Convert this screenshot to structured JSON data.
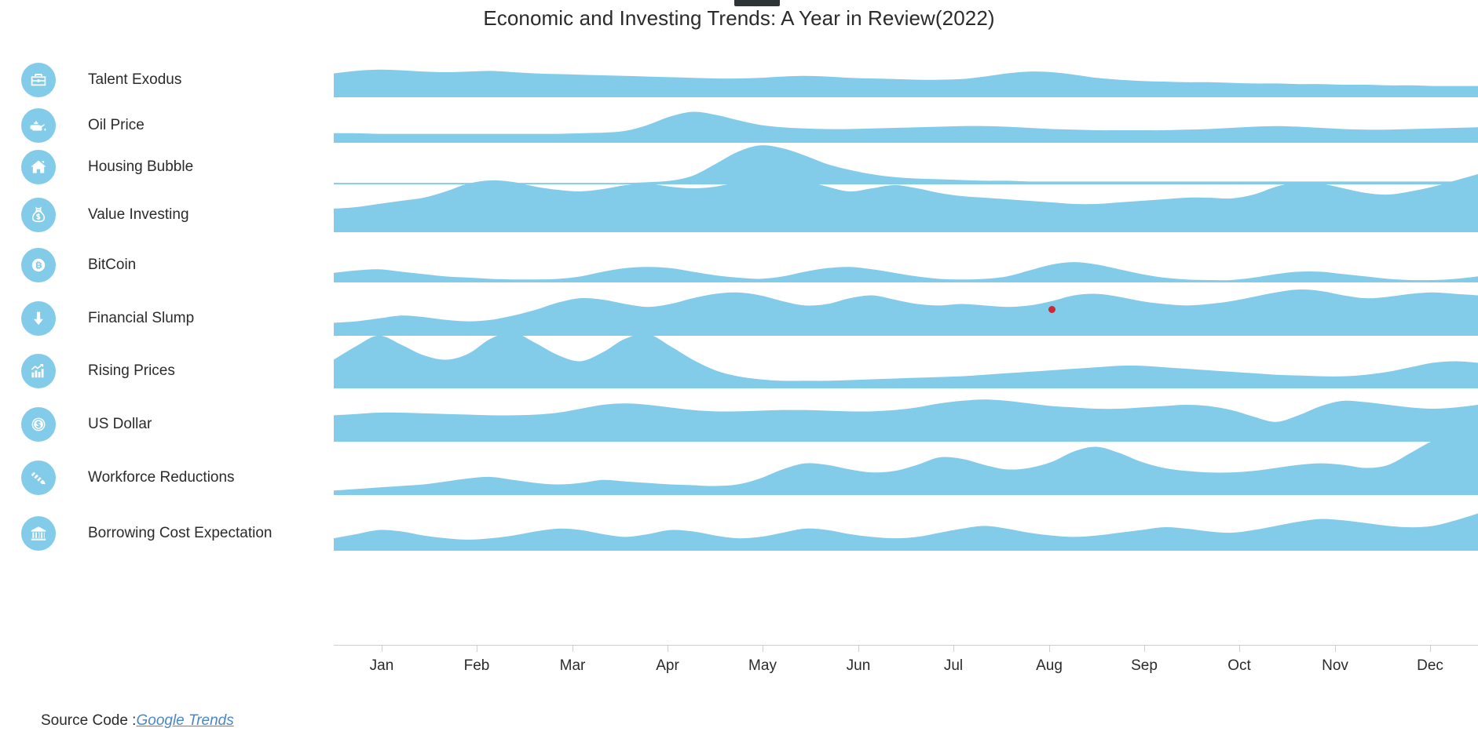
{
  "header": {
    "title": "Economic and Investing Trends: A Year in Review(2022)"
  },
  "footer": {
    "prefix": "Source Code :",
    "link_label": "Google Trends"
  },
  "colors": {
    "area_fill": "#82cce9",
    "icon_circle": "#82cce9",
    "icon_glyph": "#ffffff",
    "text": "#2b2b2b",
    "axis": "#cfcfcf",
    "link": "#4a86c8",
    "marker": "#cc2936"
  },
  "legend": {
    "items": [
      {
        "label": "Talent Exodus",
        "icon": "briefcase-icon"
      },
      {
        "label": "Oil Price",
        "icon": "oil-can-icon"
      },
      {
        "label": "Housing Bubble",
        "icon": "home-icon"
      },
      {
        "label": "Value Investing",
        "icon": "money-bag-icon"
      },
      {
        "label": "BitCoin",
        "icon": "bitcoin-icon"
      },
      {
        "label": "Financial Slump",
        "icon": "arrow-down-icon"
      },
      {
        "label": "Rising Prices",
        "icon": "bar-chart-up-icon"
      },
      {
        "label": "US Dollar",
        "icon": "dollar-coin-icon"
      },
      {
        "label": "Workforce Reductions",
        "icon": "declining-stairs-icon"
      },
      {
        "label": "Borrowing Cost Expectation",
        "icon": "bank-icon"
      }
    ]
  },
  "marker": {
    "name": "highlight-point",
    "x_pct": 62.8,
    "row": "Financial Slump"
  },
  "chart_data": {
    "type": "area",
    "variant": "ridgeline",
    "title": "Economic and Investing Trends: A Year in Review(2022)",
    "xlabel": "",
    "ylabel": "",
    "grid": false,
    "legend_position": "left",
    "x": [
      "Jan",
      "Feb",
      "Mar",
      "Apr",
      "May",
      "Jun",
      "Jul",
      "Aug",
      "Sep",
      "Oct",
      "Nov",
      "Dec"
    ],
    "xtick_labels": [
      "Jan",
      "Feb",
      "Mar",
      "Apr",
      "May",
      "Jun",
      "Jul",
      "Aug",
      "Sep",
      "Oct",
      "Nov",
      "Dec"
    ],
    "x_resolution": "weekly (52 points per series, normalized 0-100)",
    "ylim": [
      0,
      100
    ],
    "series": [
      {
        "name": "Talent Exodus",
        "color": "#82cce9",
        "values": [
          38,
          42,
          44,
          43,
          41,
          40,
          41,
          42,
          40,
          38,
          37,
          36,
          35,
          34,
          33,
          32,
          31,
          30,
          30,
          31,
          33,
          34,
          33,
          31,
          30,
          29,
          28,
          28,
          29,
          33,
          38,
          41,
          40,
          36,
          31,
          28,
          26,
          25,
          24,
          24,
          23,
          22,
          22,
          21,
          21,
          20,
          20,
          19,
          19,
          18,
          18,
          18
        ]
      },
      {
        "name": "Oil Price",
        "color": "#82cce9",
        "values": [
          16,
          16,
          15,
          15,
          15,
          15,
          15,
          15,
          15,
          15,
          15,
          16,
          17,
          20,
          30,
          44,
          52,
          47,
          38,
          30,
          26,
          24,
          23,
          23,
          24,
          25,
          26,
          27,
          28,
          28,
          27,
          25,
          23,
          22,
          21,
          21,
          21,
          21,
          22,
          23,
          25,
          27,
          28,
          27,
          25,
          23,
          22,
          22,
          23,
          24,
          25,
          26
        ]
      },
      {
        "name": "Housing Bubble",
        "color": "#82cce9",
        "values": [
          2,
          2,
          2,
          2,
          2,
          2,
          2,
          2,
          2,
          2,
          2,
          2,
          2,
          2,
          3,
          5,
          12,
          28,
          45,
          54,
          50,
          40,
          28,
          20,
          14,
          10,
          8,
          7,
          6,
          5,
          5,
          4,
          4,
          4,
          4,
          4,
          4,
          4,
          4,
          4,
          4,
          4,
          4,
          4,
          4,
          4,
          4,
          4,
          4,
          4,
          4,
          4
        ]
      },
      {
        "name": "Value Investing",
        "color": "#82cce9",
        "values": [
          30,
          32,
          36,
          40,
          44,
          52,
          62,
          66,
          64,
          58,
          54,
          52,
          55,
          60,
          62,
          58,
          56,
          58,
          64,
          70,
          72,
          66,
          58,
          52,
          56,
          60,
          56,
          50,
          46,
          44,
          42,
          40,
          38,
          36,
          36,
          38,
          40,
          42,
          44,
          44,
          43,
          48,
          58,
          64,
          62,
          56,
          50,
          48,
          52,
          58,
          66,
          74
        ]
      },
      {
        "name": "BitCoin",
        "color": "#82cce9",
        "values": [
          16,
          20,
          22,
          18,
          14,
          10,
          8,
          6,
          5,
          5,
          6,
          10,
          18,
          24,
          26,
          24,
          18,
          12,
          8,
          6,
          10,
          18,
          24,
          26,
          22,
          16,
          10,
          6,
          5,
          6,
          10,
          20,
          30,
          34,
          30,
          22,
          14,
          8,
          5,
          4,
          4,
          8,
          14,
          18,
          18,
          14,
          10,
          6,
          4,
          4,
          6,
          10
        ]
      },
      {
        "name": "Financial Slump",
        "color": "#82cce9",
        "values": [
          18,
          20,
          24,
          28,
          26,
          22,
          20,
          22,
          28,
          36,
          46,
          52,
          50,
          44,
          40,
          44,
          52,
          58,
          60,
          56,
          48,
          42,
          44,
          52,
          56,
          50,
          44,
          42,
          44,
          42,
          40,
          42,
          48,
          56,
          58,
          54,
          48,
          44,
          42,
          44,
          48,
          54,
          60,
          64,
          62,
          56,
          52,
          54,
          58,
          60,
          58,
          56
        ]
      },
      {
        "name": "Rising Prices",
        "color": "#82cce9",
        "values": [
          38,
          56,
          70,
          58,
          44,
          38,
          46,
          66,
          74,
          60,
          44,
          36,
          48,
          66,
          72,
          56,
          38,
          24,
          16,
          12,
          10,
          10,
          10,
          11,
          12,
          13,
          14,
          15,
          16,
          18,
          20,
          22,
          24,
          26,
          28,
          30,
          30,
          28,
          26,
          24,
          22,
          20,
          18,
          17,
          16,
          16,
          18,
          22,
          28,
          34,
          36,
          34
        ]
      },
      {
        "name": "US Dollar",
        "color": "#82cce9",
        "values": [
          40,
          42,
          44,
          44,
          43,
          42,
          41,
          40,
          40,
          41,
          44,
          50,
          56,
          58,
          56,
          52,
          48,
          46,
          46,
          47,
          48,
          48,
          47,
          46,
          46,
          48,
          52,
          58,
          62,
          64,
          62,
          58,
          54,
          52,
          50,
          50,
          52,
          54,
          56,
          54,
          48,
          38,
          30,
          40,
          54,
          62,
          60,
          56,
          52,
          50,
          52,
          56
        ]
      },
      {
        "name": "Workforce Reductions",
        "color": "#82cce9",
        "values": [
          6,
          8,
          10,
          12,
          14,
          18,
          22,
          24,
          20,
          16,
          14,
          16,
          20,
          18,
          16,
          14,
          13,
          12,
          14,
          22,
          34,
          42,
          40,
          34,
          30,
          32,
          40,
          50,
          48,
          40,
          34,
          36,
          44,
          58,
          64,
          56,
          44,
          36,
          32,
          30,
          30,
          32,
          36,
          40,
          42,
          40,
          36,
          40,
          56,
          72,
          80,
          76
        ]
      },
      {
        "name": "Borrowing Cost Expectation",
        "color": "#82cce9",
        "values": [
          18,
          24,
          30,
          28,
          22,
          18,
          16,
          18,
          22,
          28,
          32,
          30,
          24,
          20,
          24,
          30,
          28,
          22,
          18,
          20,
          26,
          32,
          30,
          24,
          20,
          18,
          20,
          26,
          32,
          36,
          32,
          26,
          22,
          20,
          22,
          26,
          30,
          34,
          32,
          28,
          26,
          30,
          36,
          42,
          46,
          44,
          40,
          36,
          34,
          36,
          44,
          54
        ]
      }
    ]
  }
}
